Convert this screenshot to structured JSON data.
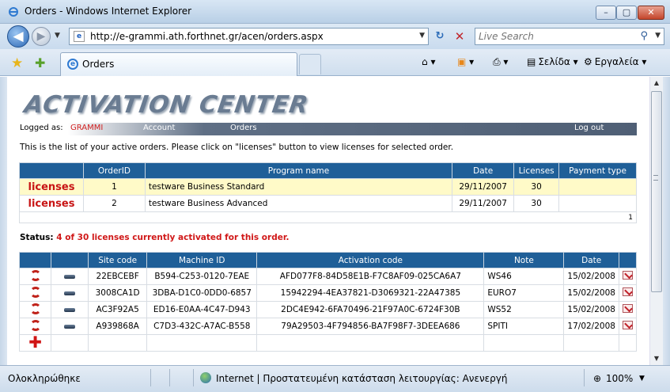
{
  "window": {
    "title": "Orders - Windows Internet Explorer",
    "min": "–",
    "max": "▢",
    "close": "✕"
  },
  "nav": {
    "url": "http://e-grammi.ath.forthnet.gr/acen/orders.aspx",
    "search_placeholder": "Live Search"
  },
  "tabs": [
    {
      "label": "Orders"
    }
  ],
  "commands": {
    "page": "Σελίδα",
    "tools": "Εργαλεία"
  },
  "page": {
    "logo": "ACTIVATION CENTER",
    "menu": {
      "logged_as": "Logged as:",
      "user": "GRAMMI",
      "account": "Account",
      "orders": "Orders",
      "logout": "Log out"
    },
    "intro": "This is the list of your active orders. Please click on \"licenses\" button to view licenses for selected order.",
    "orders_table": {
      "headers": [
        "",
        "OrderID",
        "Program name",
        "Date",
        "Licenses",
        "Payment type"
      ],
      "rows": [
        {
          "action": "licenses",
          "order_id": "1",
          "program": "testware Business Standard",
          "date": "29/11/2007",
          "licenses": "30",
          "payment": ""
        },
        {
          "action": "licenses",
          "order_id": "2",
          "program": "testware Business Advanced",
          "date": "29/11/2007",
          "licenses": "30",
          "payment": ""
        }
      ],
      "pager": "1"
    },
    "status": {
      "label": "Status:",
      "text": "4 of 30 licenses currently activated for this order."
    },
    "licenses_table": {
      "headers": [
        "",
        "Site code",
        "Machine ID",
        "Activation code",
        "Note",
        "Date"
      ],
      "rows": [
        {
          "site_code": "22EBCEBF",
          "machine_id": "B594-C253-0120-7EAE",
          "activation_code": "AFD077F8-84D58E1B-F7C8AF09-025CA6A7",
          "note": "WS46",
          "date": "15/02/2008"
        },
        {
          "site_code": "3008CA1D",
          "machine_id": "3DBA-D1C0-0DD0-6857",
          "activation_code": "15942294-4EA37821-D3069321-22A47385",
          "note": "EURO7",
          "date": "15/02/2008"
        },
        {
          "site_code": "AC3F92A5",
          "machine_id": "ED16-E0AA-4C47-D943",
          "activation_code": "2DC4E942-6FA70496-21F97A0C-6724F30B",
          "note": "WS52",
          "date": "15/02/2008"
        },
        {
          "site_code": "A939868A",
          "machine_id": "C7D3-432C-A7AC-B558",
          "activation_code": "79A29503-4F794856-BA7F98F7-3DEEA686",
          "note": "SPITI",
          "date": "17/02/2008"
        }
      ]
    }
  },
  "statusbar": {
    "left": "Ολοκληρώθηκε",
    "zone": "Internet | Προστατευμένη κατάσταση λειτουργίας: Ανενεργή",
    "zoom": "100%"
  }
}
